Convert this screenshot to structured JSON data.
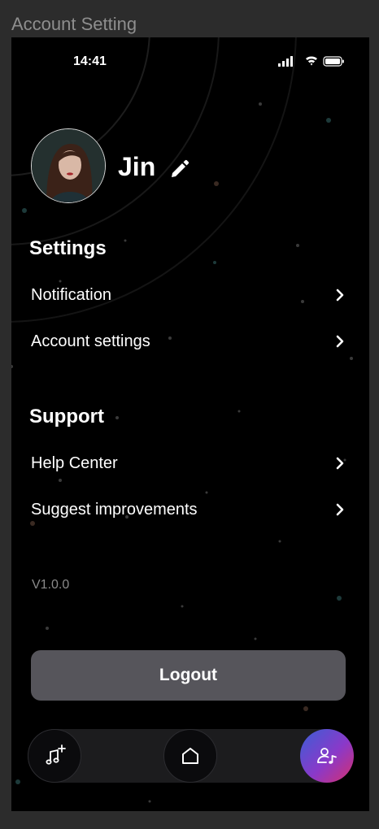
{
  "frame_title": "Account Setting",
  "status_bar": {
    "time": "14:41"
  },
  "profile": {
    "name": "Jin"
  },
  "settings": {
    "title": "Settings",
    "items": [
      {
        "label": "Notification"
      },
      {
        "label": "Account settings"
      }
    ]
  },
  "support": {
    "title": "Support",
    "items": [
      {
        "label": "Help Center"
      },
      {
        "label": "Suggest improvements"
      }
    ]
  },
  "version": "V1.0.0",
  "logout_label": "Logout",
  "bottom_nav": {
    "items": [
      {
        "icon": "music-add-icon"
      },
      {
        "icon": "home-icon"
      },
      {
        "icon": "user-music-icon",
        "active": true
      }
    ]
  },
  "colors": {
    "background": "#000000",
    "logout_button": "#56555b",
    "active_gradient": [
      "#3a5fd6",
      "#8a39c9",
      "#d6306e"
    ],
    "version_text": "#8a8a8a"
  }
}
